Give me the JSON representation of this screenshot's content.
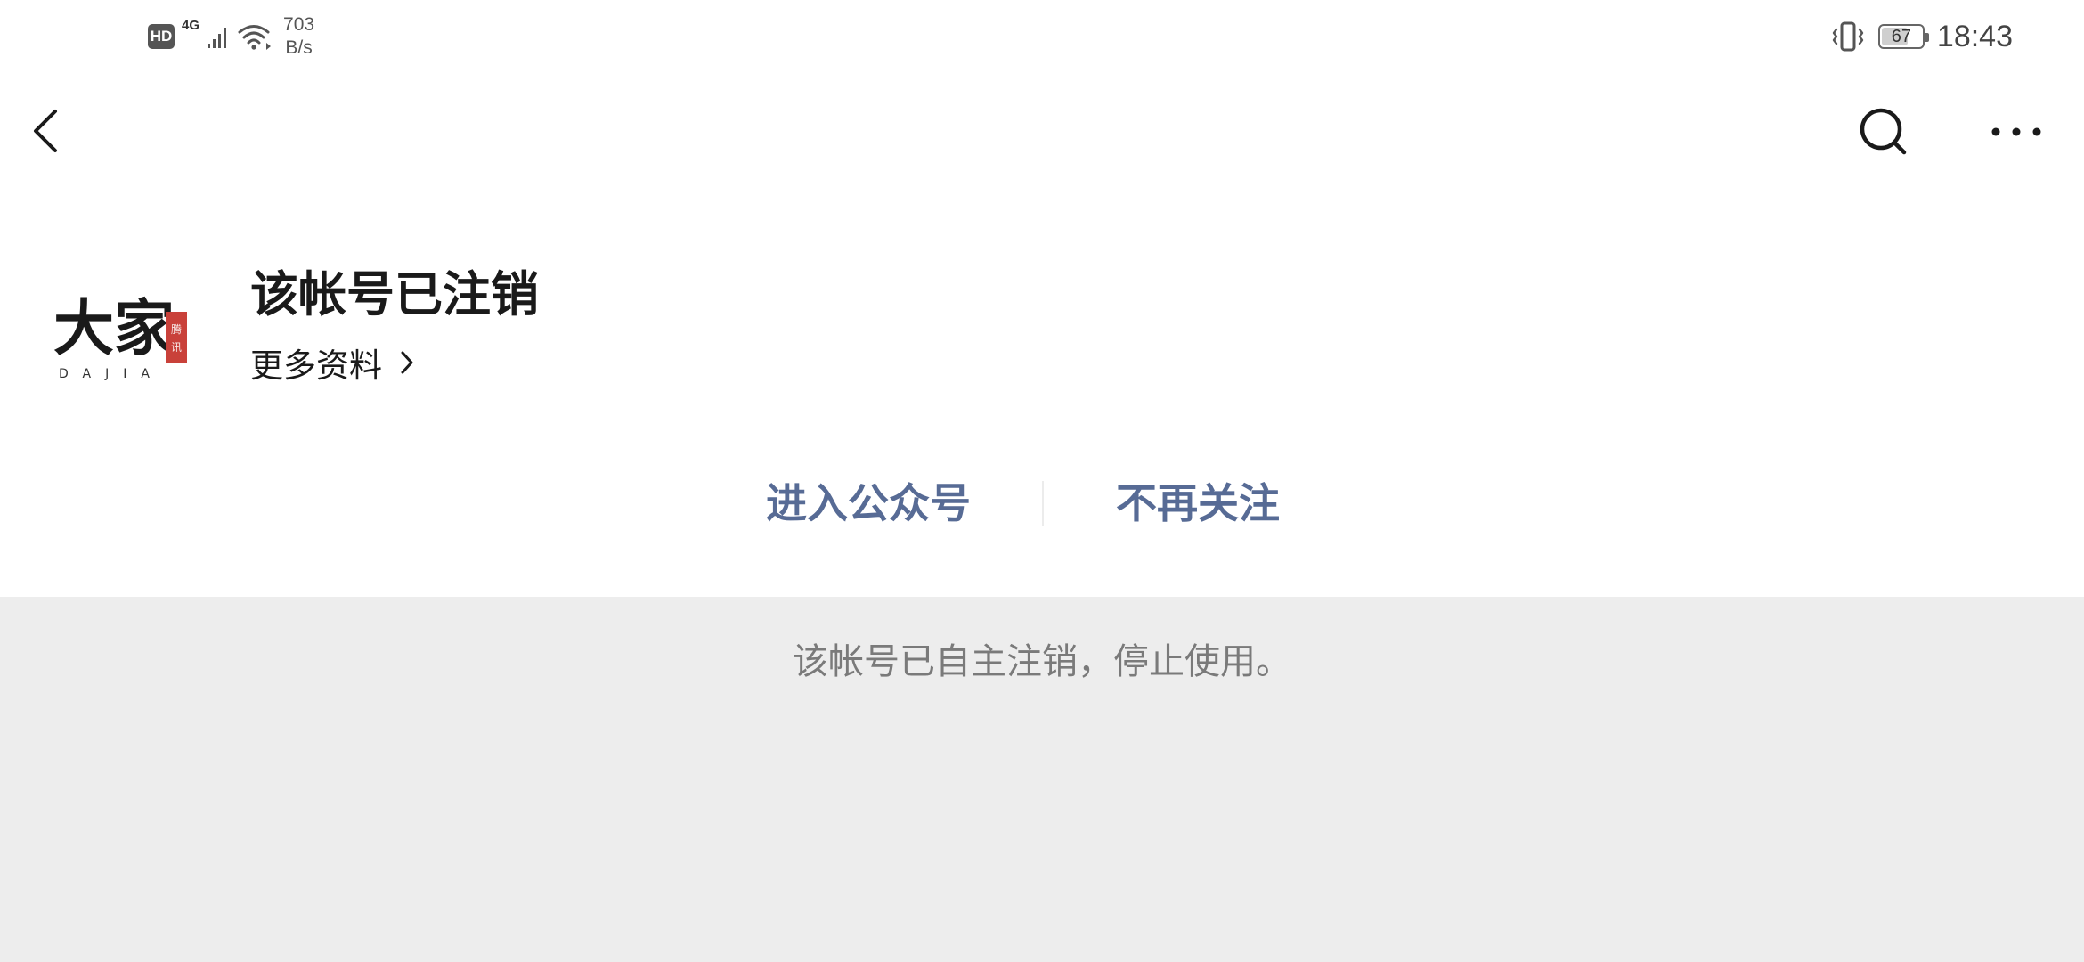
{
  "status_bar": {
    "hd_badge": "HD",
    "network_type": "4G",
    "speed_value": "703",
    "speed_unit": "B/s",
    "battery_level": "67",
    "battery_fraction": 0.67,
    "time": "18:43"
  },
  "nav": {
    "back_icon": "back-chevron-icon",
    "search_icon": "search-icon",
    "more_icon": "more-dots-icon"
  },
  "profile": {
    "avatar_icon": "dajia-logo",
    "avatar_logo_text": "大家",
    "avatar_logo_subtext": "DAJIA",
    "avatar_seal_text": "腾讯",
    "name": "该帐号已注销",
    "more_info_label": "更多资料"
  },
  "actions": {
    "enter_label": "进入公众号",
    "unfollow_label": "不再关注"
  },
  "notice": {
    "text": "该帐号已自主注销，停止使用。"
  },
  "colors": {
    "link_blue": "#576b95",
    "gray_background": "#ededed",
    "notice_text": "#7a7a7a",
    "seal_red": "#c9413a"
  }
}
